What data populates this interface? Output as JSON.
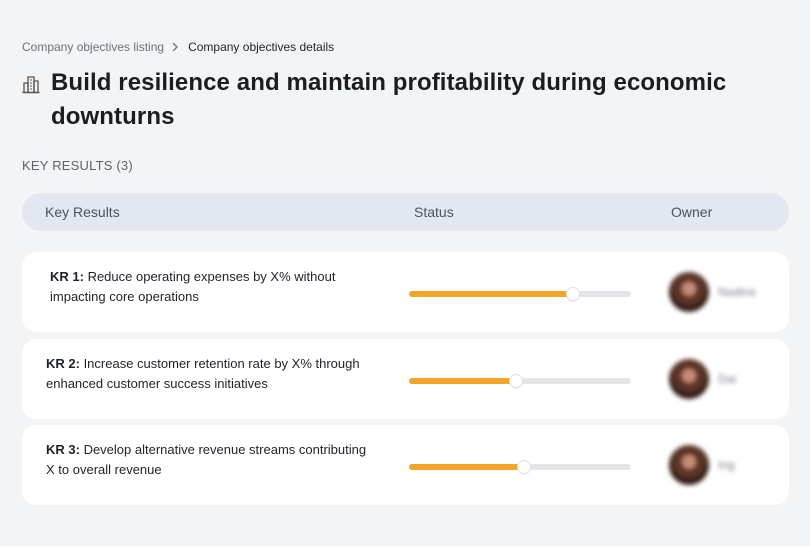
{
  "breadcrumb": {
    "parent": "Company objectives listing",
    "current": "Company objectives details"
  },
  "objective": {
    "icon": "building-icon",
    "title": "Build resilience and maintain profitability during economic downturns"
  },
  "key_results_section": {
    "label": "KEY RESULTS (3)"
  },
  "table": {
    "columns": [
      "Key Results",
      "Status",
      "Owner"
    ],
    "rows": [
      {
        "id": "KR 1:",
        "text": " Reduce operating expenses by X% without impacting core operations",
        "progress": 0.74,
        "owner": "Nadine"
      },
      {
        "id": "KR 2:",
        "text": " Increase customer retention rate by X% through enhanced customer success initiatives",
        "progress": 0.48,
        "owner": "Dai"
      },
      {
        "id": "KR 3:",
        "text": " Develop alternative revenue streams contributing X to overall revenue",
        "progress": 0.52,
        "owner": "Ing"
      }
    ]
  },
  "colors": {
    "progress_fill": "#f4a52a",
    "progress_track": "#e4e5e8",
    "header_bg": "#e3e7ef",
    "page_bg": "#f3f4f6"
  }
}
